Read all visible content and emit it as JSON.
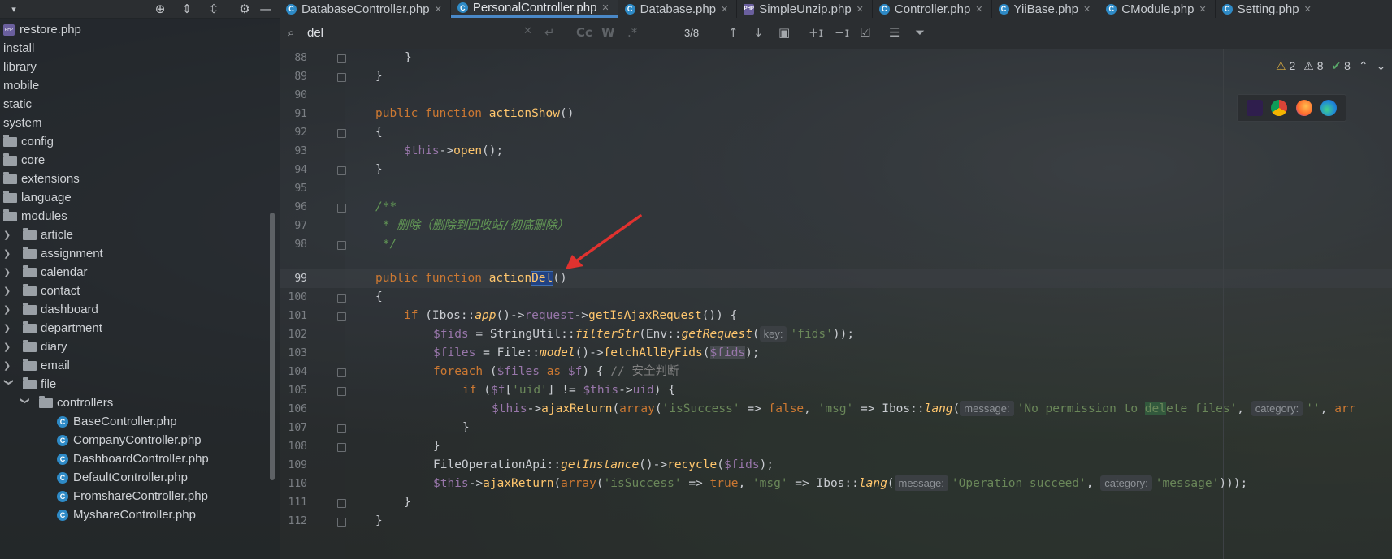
{
  "tabs": [
    {
      "label": "DatabaseController.php",
      "icon": "class-file-icon",
      "active": false
    },
    {
      "label": "PersonalController.php",
      "icon": "class-file-icon",
      "active": true
    },
    {
      "label": "Database.php",
      "icon": "class-file-icon",
      "active": false
    },
    {
      "label": "SimpleUnzip.php",
      "icon": "php-file-icon",
      "active": false
    },
    {
      "label": "Controller.php",
      "icon": "class-file-icon",
      "active": false
    },
    {
      "label": "YiiBase.php",
      "icon": "class-file-icon",
      "active": false
    },
    {
      "label": "CModule.php",
      "icon": "class-file-icon",
      "active": false
    },
    {
      "label": "Setting.php",
      "icon": "class-file-icon",
      "active": false
    }
  ],
  "tree": {
    "items": [
      {
        "label": "restore.php",
        "type": "php"
      },
      {
        "label": "install",
        "type": "dir"
      },
      {
        "label": "library",
        "type": "dir"
      },
      {
        "label": "mobile",
        "type": "dir"
      },
      {
        "label": "static",
        "type": "dir"
      },
      {
        "label": "system",
        "type": "dir"
      },
      {
        "label": "config",
        "type": "folder"
      },
      {
        "label": "core",
        "type": "folder"
      },
      {
        "label": "extensions",
        "type": "folder"
      },
      {
        "label": "language",
        "type": "folder"
      },
      {
        "label": "modules",
        "type": "folder"
      },
      {
        "label": "article",
        "type": "folder"
      },
      {
        "label": "assignment",
        "type": "folder"
      },
      {
        "label": "calendar",
        "type": "folder"
      },
      {
        "label": "contact",
        "type": "folder"
      },
      {
        "label": "dashboard",
        "type": "folder"
      },
      {
        "label": "department",
        "type": "folder"
      },
      {
        "label": "diary",
        "type": "folder"
      },
      {
        "label": "email",
        "type": "folder"
      },
      {
        "label": "file",
        "type": "folder"
      },
      {
        "label": "controllers",
        "type": "folder"
      },
      {
        "label": "BaseController.php",
        "type": "class"
      },
      {
        "label": "CompanyController.php",
        "type": "class"
      },
      {
        "label": "DashboardController.php",
        "type": "class"
      },
      {
        "label": "DefaultController.php",
        "type": "class"
      },
      {
        "label": "FromshareController.php",
        "type": "class"
      },
      {
        "label": "MyshareController.php",
        "type": "class"
      }
    ]
  },
  "find": {
    "query": "del",
    "count": "3/8",
    "match_case": "Cc",
    "words": "W",
    "regex": ".*"
  },
  "inspection": {
    "warnings": "2",
    "weak_warnings": "8",
    "ok": "8"
  },
  "editor": {
    "line_numbers": [
      "88",
      "89",
      "90",
      "91",
      "92",
      "93",
      "94",
      "95",
      "96",
      "97",
      "98",
      "99",
      "100",
      "101",
      "102",
      "103",
      "104",
      "105",
      "106",
      "107",
      "108",
      "109",
      "110",
      "111",
      "112"
    ],
    "current_line": "99",
    "hints": {
      "key": "key:",
      "message": "message:",
      "category": "category:"
    },
    "code": {
      "l88": "}",
      "l89": "}",
      "l91_kw": "public function",
      "l91_fn": "actionShow",
      "l91_rest": "()",
      "l92": "{",
      "l93_var": "$this",
      "l93_arrow": "->",
      "l93_fn": "open",
      "l93_rest": "();",
      "l94": "}",
      "l96": "/**",
      "l97": " * 删除（删除到回收站/彻底删除）",
      "l98": " */",
      "l99_kw": "public function",
      "l99_fn": "action",
      "l99_sel": "Del",
      "l99_rest": "()",
      "l100": "{",
      "l101_kw": "if",
      "l101_a": " (Ibos::",
      "l101_app": "app",
      "l101_b": "()->",
      "l101_req": "request",
      "l101_c": "->",
      "l101_fn": "getIsAjaxRequest",
      "l101_d": "()) {",
      "l102_var": "$fids",
      "l102_a": " = StringUtil::",
      "l102_fn": "filterStr",
      "l102_b": "(Env::",
      "l102_fn2": "getRequest",
      "l102_c": "(",
      "l102_str": "'fids'",
      "l102_d": "));",
      "l103_var": "$files",
      "l103_a": " = File::",
      "l103_fn": "model",
      "l103_b": "()->",
      "l103_fn2": "fetchAllByFids",
      "l103_c": "(",
      "l103_var2": "$fids",
      "l103_d": ");",
      "l104_kw": "foreach",
      "l104_a": " (",
      "l104_var": "$files",
      "l104_kw2": " as ",
      "l104_var2": "$f",
      "l104_b": ") { ",
      "l104_cm": "// 安全判断",
      "l105_kw": "if",
      "l105_a": " (",
      "l105_var": "$f",
      "l105_b": "[",
      "l105_str": "'uid'",
      "l105_c": "] != ",
      "l105_var2": "$this",
      "l105_d": "->",
      "l105_e": "uid",
      "l105_f": ") {",
      "l106_var": "$this",
      "l106_a": "->",
      "l106_fn": "ajaxReturn",
      "l106_b": "(",
      "l106_kw": "array",
      "l106_c": "(",
      "l106_str": "'isSuccess'",
      "l106_d": " => ",
      "l106_kw2": "false",
      "l106_e": ", ",
      "l106_str2": "'msg'",
      "l106_f": " => Ibos::",
      "l106_fn2": "lang",
      "l106_g": "(",
      "l106_str3a": "'No permission to ",
      "l106_match": "del",
      "l106_str3b": "ete files'",
      "l106_h": ", ",
      "l106_str4": "''",
      "l106_i": ", ",
      "l106_tail": "arr",
      "l107": "}",
      "l108": "}",
      "l109_a": "FileOperationApi::",
      "l109_fn": "getInstance",
      "l109_b": "()->",
      "l109_fn2": "recycle",
      "l109_c": "(",
      "l109_var": "$fids",
      "l109_d": ");",
      "l110_var": "$this",
      "l110_a": "->",
      "l110_fn": "ajaxReturn",
      "l110_b": "(",
      "l110_kw": "array",
      "l110_c": "(",
      "l110_str": "'isSuccess'",
      "l110_d": " => ",
      "l110_kw2": "true",
      "l110_e": ", ",
      "l110_str2": "'msg'",
      "l110_f": " => Ibos::",
      "l110_fn2": "lang",
      "l110_g": "(",
      "l110_str3": "'Operation succeed'",
      "l110_h": ", ",
      "l110_str4": "'message'",
      "l110_i": ")));",
      "l111": "}",
      "l112": "}"
    }
  },
  "colors": {
    "keyword": "#cc7832",
    "function": "#ffc66d",
    "variable": "#9876aa",
    "string": "#6a8759",
    "comment": "#629755",
    "active_tab_underline": "#4a88c7",
    "annotation_arrow": "#e0322f"
  }
}
